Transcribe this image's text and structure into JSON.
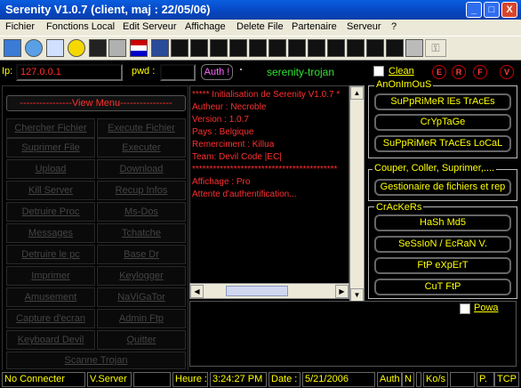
{
  "window": {
    "title": "Serenity V1.0.7 (client, maj : 22/05/06)",
    "min_glyph": "_",
    "max_glyph": "□",
    "close_glyph": "X"
  },
  "menu": [
    "Fichier",
    "Fonctions Local",
    "Edit Serveur",
    "Affichage",
    "Delete File",
    "Partenaire",
    "Serveur",
    "?"
  ],
  "toolbar_icons": [
    "server-icon",
    "globe-icon",
    "ie-icon",
    "smiley-icon",
    "dos-icon",
    "gear-icon",
    "flag-icon",
    "monitor-icon",
    "black-icon-1",
    "black-icon-2",
    "black-icon-3",
    "black-icon-4",
    "black-icon-5",
    "black-icon-6",
    "black-icon-7",
    "black-icon-8",
    "black-icon-9",
    "black-icon-10",
    "black-icon-11",
    "black-icon-12",
    "gray-box-icon",
    "key-icon"
  ],
  "connection": {
    "ip_label": "Ip:",
    "ip_value": "127.0.0.1",
    "pwd_label": "pwd :",
    "pwd_value": "",
    "auth_label": "Auth !",
    "server_name": "serenity-trojan",
    "clean_label": "Clean",
    "circles": [
      "E",
      "R",
      "F",
      "V"
    ]
  },
  "left_panel": {
    "view_menu": "----------------View Menu----------------",
    "buttons": [
      [
        "Chercher Fichier",
        "Execute Fichier"
      ],
      [
        "Suprimer File",
        "Executer"
      ],
      [
        "Upload",
        "Download"
      ],
      [
        "Kill Server",
        "Recup Infos"
      ],
      [
        "Detruire Proc",
        "Ms-Dos"
      ],
      [
        "Messages",
        "Tchatche"
      ],
      [
        "Detruire le pc",
        "Base Dr"
      ],
      [
        "Imprimer",
        "Keylogger"
      ],
      [
        "Amusement",
        "NaViGaTor"
      ],
      [
        "Capture d'ecran",
        "Admin Ftp"
      ],
      [
        "Keyboard Devil",
        "Quitter"
      ]
    ],
    "bottom_button": "Scanne Trojan"
  },
  "console_lines": [
    "***** Initialisation de Serenity V1.0.7 *",
    "Autheur : Necroble",
    "Version : 1.0.7",
    "Pays : Belgique",
    "Remerciment : Killua",
    "Team: Devil Code |EC|",
    "******************************************",
    "Affichage : Pro",
    "Attente d'authentification..."
  ],
  "groups": {
    "anonimous": {
      "label": "AnOnImOuS",
      "buttons": [
        "SuPpRiMeR lEs TrAcEs",
        "CrYpTaGe",
        "SuPpRiMeR TrAcEs LoCaL"
      ]
    },
    "couper": {
      "label": "Couper, Coller, Suprimer,....",
      "buttons": [
        "Gestionaire de fichiers et rep"
      ]
    },
    "crackers": {
      "label": "CrAcKeRs",
      "buttons": [
        "HaSh Md5",
        "SeSsIoN / EcRaN V.",
        "FtP eXpErT",
        "CuT FtP"
      ]
    }
  },
  "powa_label": "Powa",
  "status": {
    "connection": "No Connecter",
    "server_label": "V.Server",
    "heure_label": "Heure :",
    "heure_value": "3:24:27 PM",
    "date_label": "Date :",
    "date_value": "5/21/2006",
    "auth_label": "Auth",
    "auth_value": "N",
    "kos_label": "Ko/s",
    "p_label": "P.",
    "proto": "TCP"
  }
}
